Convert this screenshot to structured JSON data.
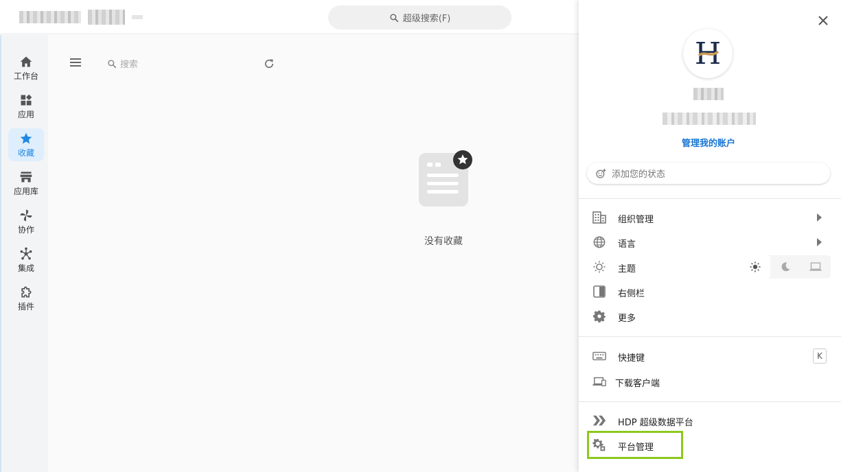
{
  "topbar": {
    "super_search_label": "超级搜索(F)"
  },
  "rail": {
    "items": [
      {
        "label": "工作台",
        "icon": "home-icon"
      },
      {
        "label": "应用",
        "icon": "apps-icon"
      },
      {
        "label": "收藏",
        "icon": "star-icon",
        "active": true
      },
      {
        "label": "应用库",
        "icon": "store-icon"
      },
      {
        "label": "协作",
        "icon": "pinwheel-icon"
      },
      {
        "label": "集成",
        "icon": "hub-icon"
      },
      {
        "label": "插件",
        "icon": "puzzle-icon"
      }
    ],
    "accent": "#1e88e5"
  },
  "main": {
    "search_placeholder": "搜索",
    "empty_text": "没有收藏"
  },
  "panel": {
    "manage_account": "管理我的账户",
    "status_placeholder": "添加您的状态",
    "menu": {
      "org": "组织管理",
      "language": "语言",
      "theme": "主题",
      "right_sidebar": "右侧栏",
      "more": "更多",
      "shortcuts": "快捷键",
      "shortcut_key": "K",
      "download_client": "下载客户端",
      "hdp": "HDP 超级数据平台",
      "platform_admin": "平台管理"
    },
    "highlight_color": "#8dc81d",
    "logo_letter": "H"
  }
}
